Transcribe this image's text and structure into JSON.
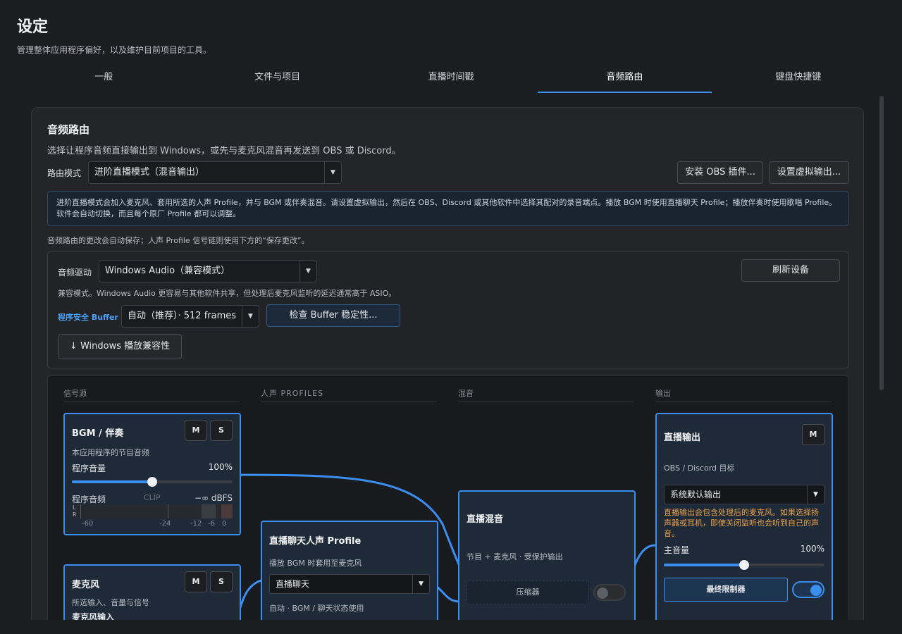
{
  "page": {
    "title": "设定",
    "subtitle": "管理整体应用程序偏好，以及维护目前项目的工具。"
  },
  "tabs": [
    {
      "label": "一般",
      "active": false
    },
    {
      "label": "文件与项目",
      "active": false
    },
    {
      "label": "直播时间戳",
      "active": false
    },
    {
      "label": "音频路由",
      "active": true
    },
    {
      "label": "键盘快捷键",
      "active": false
    }
  ],
  "routing": {
    "heading": "音频路由",
    "description": "选择让程序音频直接输出到 Windows，或先与麦克风混音再发送到 OBS 或 Discord。",
    "mode_label": "路由模式",
    "mode_value": "进阶直播模式（混音输出）",
    "install_obs_button": "安装 OBS 插件...",
    "virtual_output_button": "设置虚拟输出...",
    "info": "进阶直播模式会加入麦克风、套用所选的人声 Profile，并与 BGM 或伴奏混音。请设置虚拟输出，然后在 OBS、Discord 或其他软件中选择其配对的录音端点。播放 BGM 时使用直播聊天 Profile；播放伴奏时使用歌唱 Profile。软件会自动切换，而且每个原厂 Profile 都可以调整。",
    "autosave_note": "音频路由的更改会自动保存；人声 Profile 信号链则使用下方的“保存更改”。"
  },
  "driver": {
    "label": "音频驱动",
    "value": "Windows Audio（兼容模式）",
    "refresh_button": "刷新设备",
    "compat_note": "兼容模式。Windows Audio 更容易与其他软件共享，但处理后麦克风监听的延迟通常高于 ASIO。",
    "buffer_label": "程序安全 Buffer",
    "buffer_value": "自动（推荐）· 512 frames",
    "check_buffer_button": "检查 Buffer 稳定性...",
    "compat_toggle_arrow": "↓",
    "compat_toggle": "Windows 播放兼容性"
  },
  "graph": {
    "columns": [
      "信号源",
      "人声 PROFILES",
      "混音",
      "输出"
    ],
    "bgm": {
      "title": "BGM / 伴奏",
      "subtitle": "本应用程序的节目音频",
      "mute": "M",
      "solo": "S",
      "volume_label": "程序音量",
      "volume_value": "100%",
      "volume_level": 0.5,
      "meter_label": "程序音频",
      "clip": "CLIP",
      "dbfs": "−∞ dBFS",
      "channel_l": "L",
      "channel_r": "R",
      "scale": [
        "-60",
        "-24",
        "-12",
        "-6",
        "0"
      ]
    },
    "mic": {
      "title": "麦克风",
      "subtitle": "所选输入、音量与信号",
      "mute": "M",
      "solo": "S",
      "input_label": "麦克风输入"
    },
    "profile": {
      "title": "直播聊天人声 Profile",
      "subtitle": "播放 BGM 时套用至麦克风",
      "select_value": "直播聊天",
      "auto_note": "自动 · BGM / 聊天状态使用"
    },
    "mix": {
      "title": "直播混音",
      "subtitle": "节目 + 麦克风 · 受保护输出",
      "compressor": "压缩器",
      "compressor_on": false
    },
    "output": {
      "title": "直播输出",
      "mute": "M",
      "subtitle": "OBS / Discord 目标",
      "device": "系统默认输出",
      "warning": "直播输出会包含处理后的麦克风。如果选择扬声器或耳机，即使关闭监听也会听到自己的声音。",
      "volume_label": "主音量",
      "volume_value": "100%",
      "volume_level": 0.5,
      "limiter": "最终限制器",
      "limiter_on": true
    }
  },
  "colors": {
    "accent": "#3a8ef0",
    "warning": "#e8a24a",
    "node_bg": "#1e2a38"
  }
}
